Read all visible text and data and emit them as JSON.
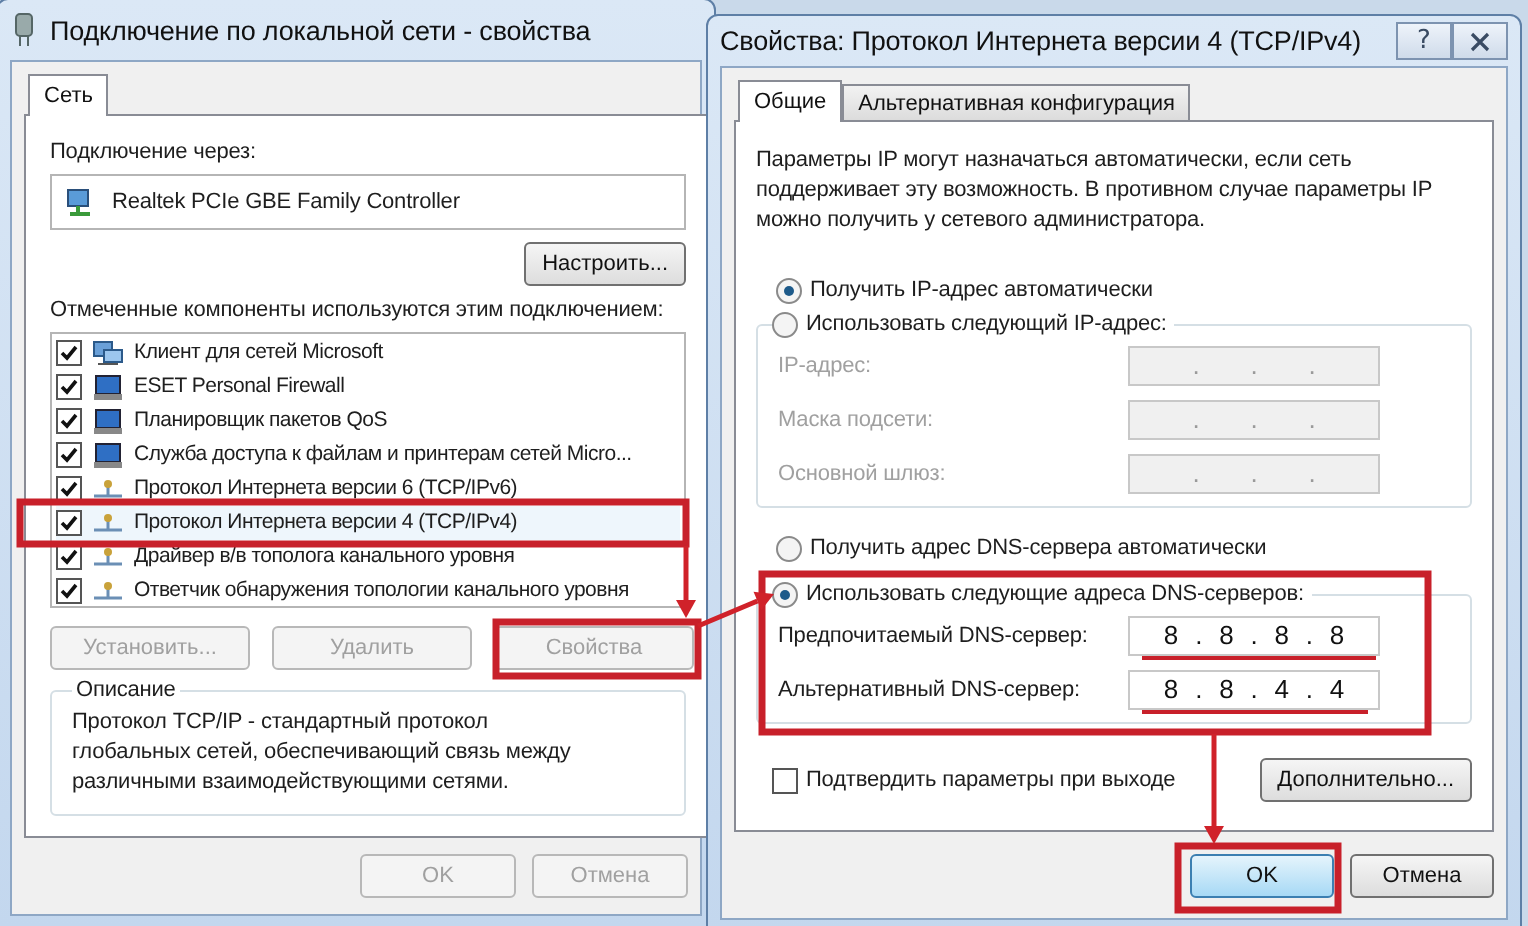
{
  "left_window": {
    "title": "Подключение по локальной сети - свойства",
    "tabs": [
      {
        "label": "Сеть",
        "selected": true
      }
    ],
    "connect_via_label": "Подключение через:",
    "adapter": "Realtek PCIe GBE Family Controller",
    "configure_button": "Настроить...",
    "components_label": "Отмеченные компоненты используются этим подключением:",
    "components": [
      {
        "kind": "client",
        "label": "Клиент для сетей Microsoft",
        "checked": true,
        "selected": false
      },
      {
        "kind": "service",
        "label": "ESET Personal Firewall",
        "checked": true,
        "selected": false
      },
      {
        "kind": "service",
        "label": "Планировщик пакетов QoS",
        "checked": true,
        "selected": false
      },
      {
        "kind": "service",
        "label": "Служба доступа к файлам и принтерам сетей Micro...",
        "checked": true,
        "selected": false
      },
      {
        "kind": "protocol",
        "label": "Протокол Интернета версии 6 (TCP/IPv6)",
        "checked": true,
        "selected": false
      },
      {
        "kind": "protocol",
        "label": "Протокол Интернета версии 4 (TCP/IPv4)",
        "checked": true,
        "selected": true
      },
      {
        "kind": "protocol",
        "label": "Драйвер в/в тополога канального уровня",
        "checked": true,
        "selected": false
      },
      {
        "kind": "protocol",
        "label": "Ответчик обнаружения топологии канального уровня",
        "checked": true,
        "selected": false
      }
    ],
    "action_buttons": [
      {
        "label": "Установить...",
        "disabled": true
      },
      {
        "label": "Удалить",
        "disabled": true
      },
      {
        "label": "Свойства",
        "disabled": true
      }
    ],
    "description": {
      "legend": "Описание",
      "text": "Протокол TCP/IP - стандартный протокол глобальных сетей, обеспечивающий связь между различными взаимодействующими сетями."
    },
    "footer_buttons": [
      {
        "label": "OK",
        "disabled": true
      },
      {
        "label": "Отмена",
        "disabled": true
      }
    ]
  },
  "right_window": {
    "title": "Свойства: Протокол Интернета версии 4 (TCP/IPv4)",
    "help_button": "?",
    "tabs": [
      {
        "label": "Общие",
        "selected": true
      },
      {
        "label": "Альтернативная конфигурация",
        "selected": false
      }
    ],
    "intro": "Параметры IP могут назначаться автоматически, если сеть поддерживает эту возможность. В противном случае параметры IP можно получить у сетевого администратора.",
    "ip_auto": {
      "label": "Получить IP-адрес автоматически",
      "selected": true
    },
    "ip_manual": {
      "label": "Использовать следующий IP-адрес:",
      "selected": false,
      "fields": [
        {
          "label": "IP-адрес:",
          "value": ".   .   .",
          "disabled": true
        },
        {
          "label": "Маска подсети:",
          "value": ".   .   .",
          "disabled": true
        },
        {
          "label": "Основной шлюз:",
          "value": ".   .   .",
          "disabled": true
        }
      ]
    },
    "dns_auto": {
      "label": "Получить адрес DNS-сервера автоматически",
      "selected": false
    },
    "dns_manual": {
      "label": "Использовать следующие адреса DNS-серверов:",
      "selected": true,
      "fields": [
        {
          "label": "Предпочитаемый DNS-сервер:",
          "value": "8 . 8 . 8 . 8",
          "disabled": false
        },
        {
          "label": "Альтернативный DNS-сервер:",
          "value": "8 . 8 . 4 . 4",
          "disabled": false
        }
      ]
    },
    "validate_checkbox": {
      "label": "Подтвердить параметры при выходе",
      "checked": false
    },
    "advanced_button": "Дополнительно...",
    "footer_buttons": [
      {
        "label": "OK",
        "default": true
      },
      {
        "label": "Отмена",
        "default": false
      }
    ]
  }
}
